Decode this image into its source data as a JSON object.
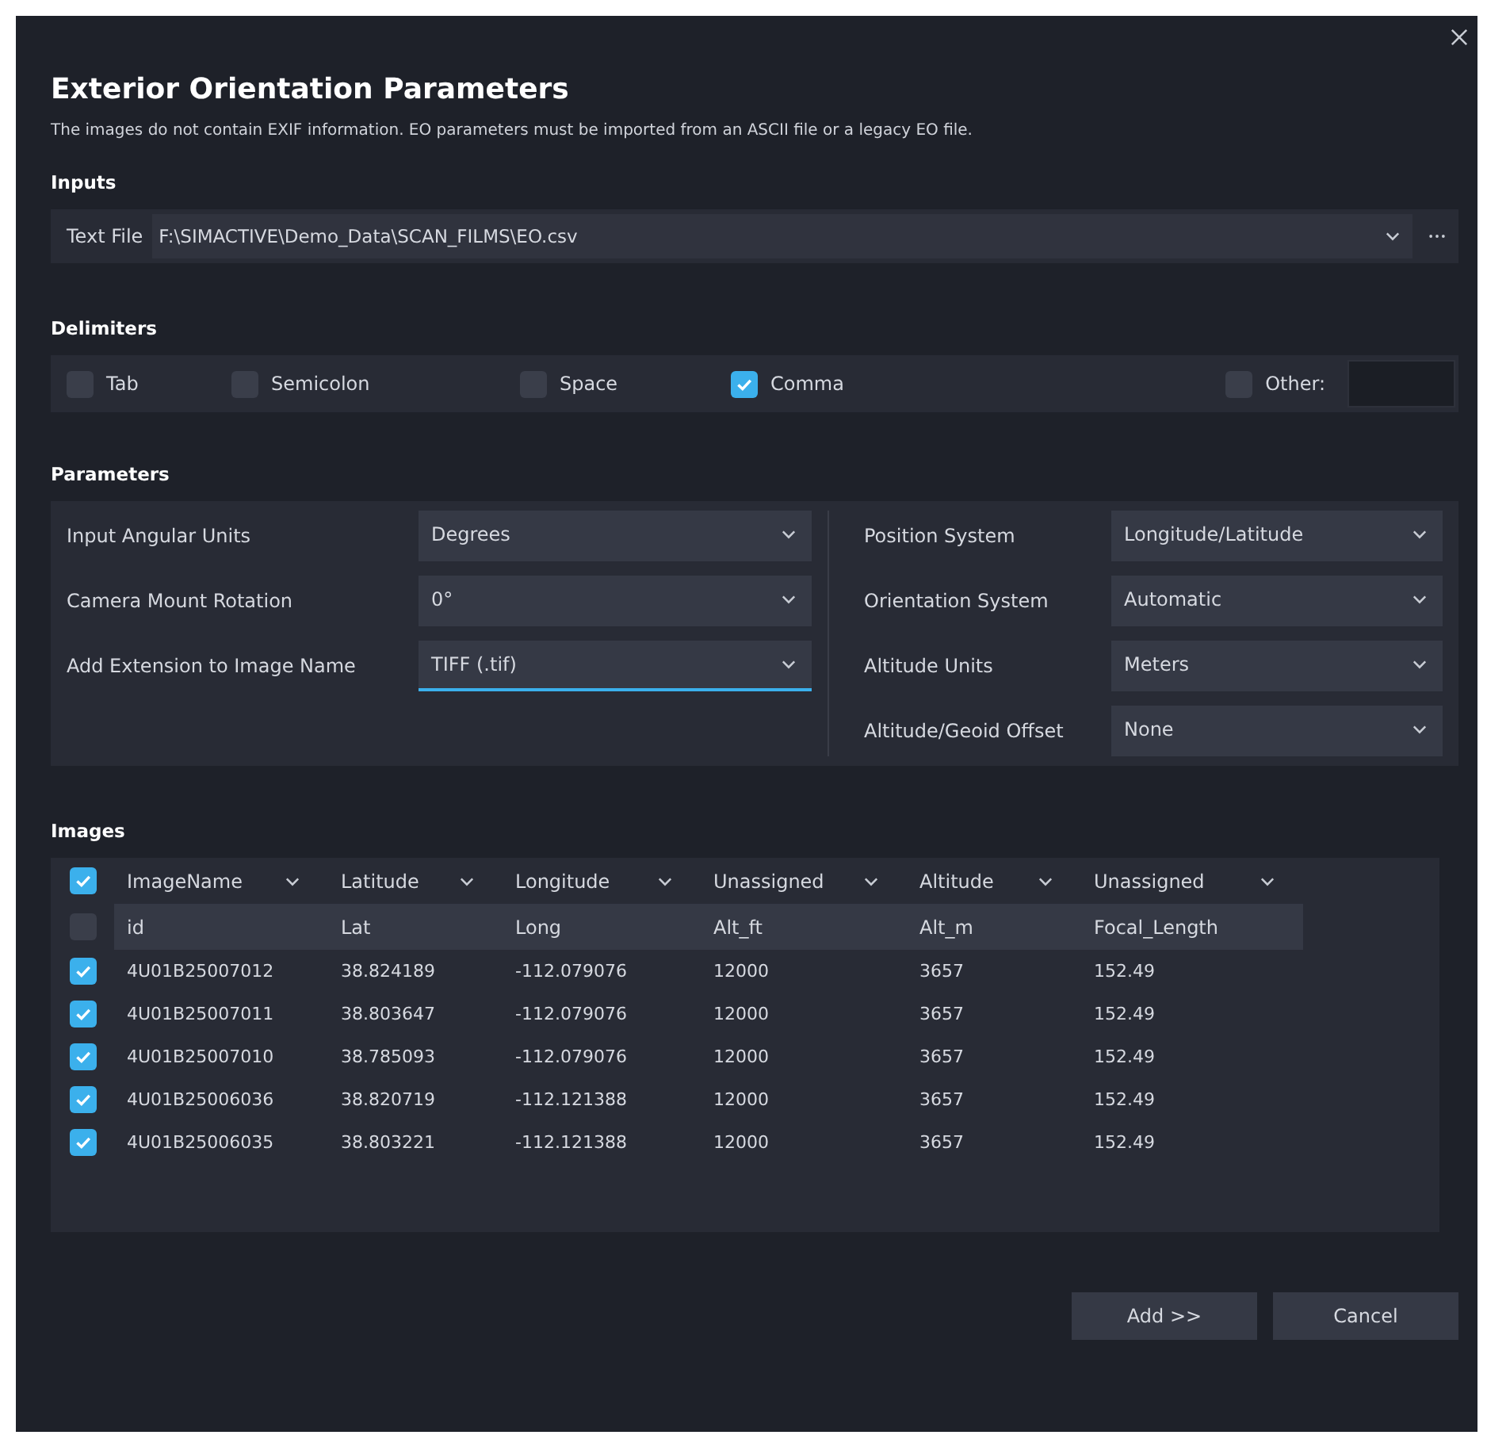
{
  "dialog": {
    "title": "Exterior Orientation Parameters",
    "description": "The images do not contain EXIF information. EO parameters must be imported from an ASCII file or a legacy EO file."
  },
  "inputs": {
    "heading": "Inputs",
    "text_file": {
      "label": "Text File",
      "value": "F:\\SIMACTIVE\\Demo_Data\\SCAN_FILMS\\EO.csv"
    }
  },
  "delimiters": {
    "heading": "Delimiters",
    "options": [
      {
        "label": "Tab",
        "checked": false
      },
      {
        "label": "Semicolon",
        "checked": false
      },
      {
        "label": "Space",
        "checked": false
      },
      {
        "label": "Comma",
        "checked": true
      }
    ],
    "other": {
      "label": "Other:",
      "checked": false
    }
  },
  "parameters": {
    "heading": "Parameters",
    "left": [
      {
        "label": "Input Angular Units",
        "value": "Degrees",
        "focused": false
      },
      {
        "label": "Camera Mount Rotation",
        "value": "0°",
        "focused": false
      },
      {
        "label": "Add Extension to Image Name",
        "value": "TIFF (.tif)",
        "focused": true
      }
    ],
    "right": [
      {
        "label": "Position System",
        "value": "Longitude/Latitude",
        "focused": false
      },
      {
        "label": "Orientation System",
        "value": "Automatic",
        "focused": false
      },
      {
        "label": "Altitude Units",
        "value": "Meters",
        "focused": false
      },
      {
        "label": "Altitude/Geoid Offset",
        "value": "None",
        "focused": false
      }
    ]
  },
  "images": {
    "heading": "Images",
    "select_all": true,
    "field_row_checked": false,
    "columns": [
      {
        "name": "ImageName",
        "field": "id"
      },
      {
        "name": "Latitude",
        "field": "Lat"
      },
      {
        "name": "Longitude",
        "field": "Long"
      },
      {
        "name": "Unassigned",
        "field": "Alt_ft"
      },
      {
        "name": "Altitude",
        "field": "Alt_m"
      },
      {
        "name": "Unassigned",
        "field": "Focal_Length"
      }
    ],
    "rows": [
      {
        "checked": true,
        "cells": [
          "4U01B25007012",
          "38.824189",
          "-112.079076",
          "12000",
          "3657",
          "152.49"
        ]
      },
      {
        "checked": true,
        "cells": [
          "4U01B25007011",
          "38.803647",
          "-112.079076",
          "12000",
          "3657",
          "152.49"
        ]
      },
      {
        "checked": true,
        "cells": [
          "4U01B25007010",
          "38.785093",
          "-112.079076",
          "12000",
          "3657",
          "152.49"
        ]
      },
      {
        "checked": true,
        "cells": [
          "4U01B25006036",
          "38.820719",
          "-112.121388",
          "12000",
          "3657",
          "152.49"
        ]
      },
      {
        "checked": true,
        "cells": [
          "4U01B25006035",
          "38.803221",
          "-112.121388",
          "12000",
          "3657",
          "152.49"
        ]
      }
    ]
  },
  "buttons": [
    {
      "label": "Add >>"
    },
    {
      "label": "Cancel"
    }
  ]
}
